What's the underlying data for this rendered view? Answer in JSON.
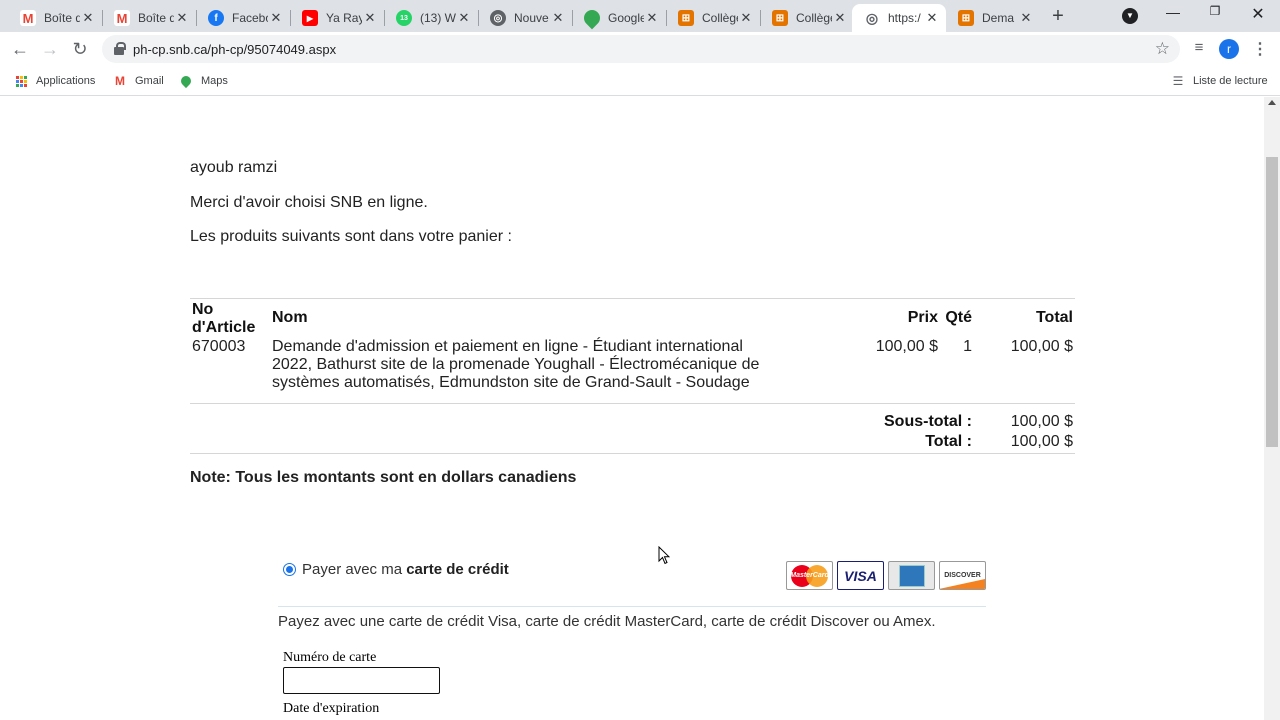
{
  "browser": {
    "tabs": [
      {
        "title": "Boîte d",
        "icon": "gmail-icon",
        "color": "#ea4335",
        "glyph": "M"
      },
      {
        "title": "Boîte d",
        "icon": "gmail-icon",
        "color": "#ea4335",
        "glyph": "M"
      },
      {
        "title": "Facebo",
        "icon": "facebook-icon",
        "color": "#1877f2",
        "glyph": "f"
      },
      {
        "title": "Ya Ray",
        "icon": "youtube-icon",
        "color": "#ff0000",
        "glyph": "▶"
      },
      {
        "title": "(13) W",
        "icon": "whatsapp-icon",
        "color": "#25d366",
        "glyph": "13"
      },
      {
        "title": "Nouve",
        "icon": "chrome-icon",
        "color": "#5f6368",
        "glyph": "◎"
      },
      {
        "title": "Google",
        "icon": "maps-icon",
        "color": "#34a853",
        "glyph": "●"
      },
      {
        "title": "Collège",
        "icon": "college-icon",
        "color": "#e37400",
        "glyph": "⊞"
      },
      {
        "title": "Collège",
        "icon": "college-icon",
        "color": "#e37400",
        "glyph": "⊞"
      },
      {
        "title": "https:/",
        "icon": "globe-icon",
        "color": "#5f6368",
        "glyph": "◎",
        "active": true
      },
      {
        "title": "Dema",
        "icon": "college-icon",
        "color": "#e37400",
        "glyph": "⊞"
      }
    ],
    "url": "ph-cp.snb.ca/ph-cp/95074049.aspx",
    "profile_initial": "r",
    "bookmarks": [
      {
        "label": "Applications",
        "icon": "apps-grid-icon"
      },
      {
        "label": "Gmail",
        "icon": "gmail-icon"
      },
      {
        "label": "Maps",
        "icon": "maps-icon"
      }
    ],
    "reading_list": "Liste de lecture"
  },
  "page": {
    "customer_name": "ayoub ramzi",
    "thanks": "Merci d'avoir choisi SNB en ligne.",
    "cart_intro": "Les produits suivants sont dans votre panier :",
    "cart": {
      "headers": {
        "article_no_line1": "No",
        "article_no_line2": "d'Article",
        "name": "Nom",
        "price": "Prix",
        "qty": "Qté",
        "total": "Total"
      },
      "items": [
        {
          "article_no": "670003",
          "name_line1": "Demande d'admission et paiement en ligne - Étudiant international",
          "name_line2": "2022, Bathurst site de la promenade Youghall - Électromécanique de",
          "name_line3": "systèmes automatisés, Edmundston site de Grand-Sault - Soudage",
          "price": "100,00 $",
          "qty": "1",
          "total": "100,00 $"
        }
      ],
      "subtotal_label": "Sous-total :",
      "subtotal_value": "100,00 $",
      "total_label": "Total :",
      "total_value": "100,00 $"
    },
    "note": "Note: Tous les montants sont en dollars canadiens",
    "payment": {
      "option_prefix": "Payer avec ma ",
      "option_bold": "carte de crédit",
      "selected": true,
      "cards": [
        "MasterCard",
        "VISA",
        "American Express",
        "DISCOVER"
      ],
      "description": "Payez avec une carte de crédit Visa, carte de crédit MasterCard, carte de crédit Discover ou Amex.",
      "card_number_label": "Numéro de carte",
      "card_number_value": "",
      "expiry_label": "Date d'expiration"
    }
  }
}
